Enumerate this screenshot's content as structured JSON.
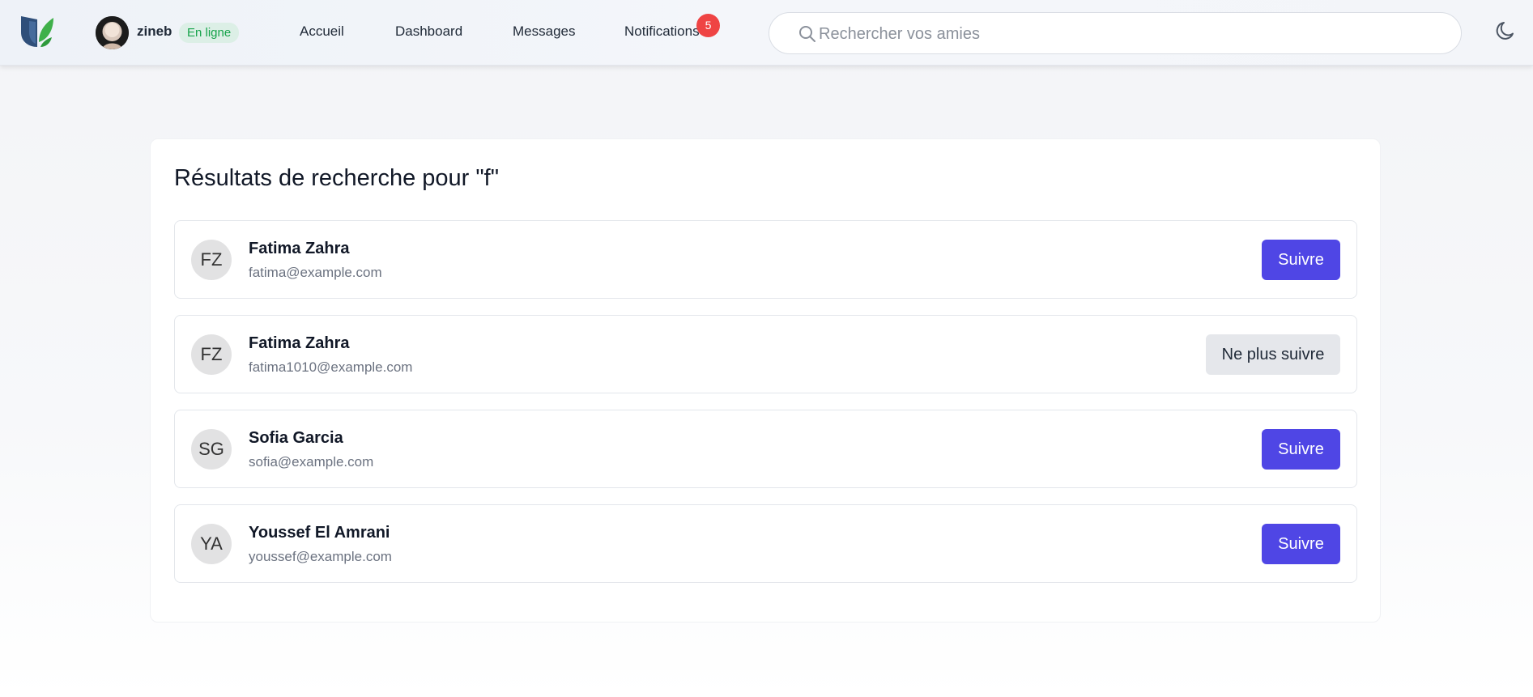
{
  "header": {
    "user": {
      "name": "zineb",
      "status": "En ligne"
    },
    "nav": [
      {
        "label": "Accueil"
      },
      {
        "label": "Dashboard"
      },
      {
        "label": "Messages"
      },
      {
        "label": "Notifications"
      }
    ],
    "notifications_count": "5",
    "search": {
      "value": "",
      "placeholder": "Rechercher vos amies"
    }
  },
  "main": {
    "title": "Résultats de recherche pour \"f\"",
    "results": [
      {
        "initials": "FZ",
        "name": "Fatima Zahra",
        "email": "fatima@example.com",
        "action": "Suivre"
      },
      {
        "initials": "FZ",
        "name": "Fatima Zahra",
        "email": "fatima1010@example.com",
        "action": "Ne plus suivre"
      },
      {
        "initials": "SG",
        "name": "Sofia Garcia",
        "email": "sofia@example.com",
        "action": "Suivre"
      },
      {
        "initials": "YA",
        "name": "Youssef El Amrani",
        "email": "youssef@example.com",
        "action": "Suivre"
      }
    ]
  },
  "colors": {
    "accent": "#4f46e5",
    "online": "#16a34a",
    "notification": "#ef4444",
    "unfollow_bg": "#e5e7eb"
  },
  "icons": {
    "logo": "app-logo-icon",
    "search": "search-icon",
    "theme": "moon-icon"
  }
}
